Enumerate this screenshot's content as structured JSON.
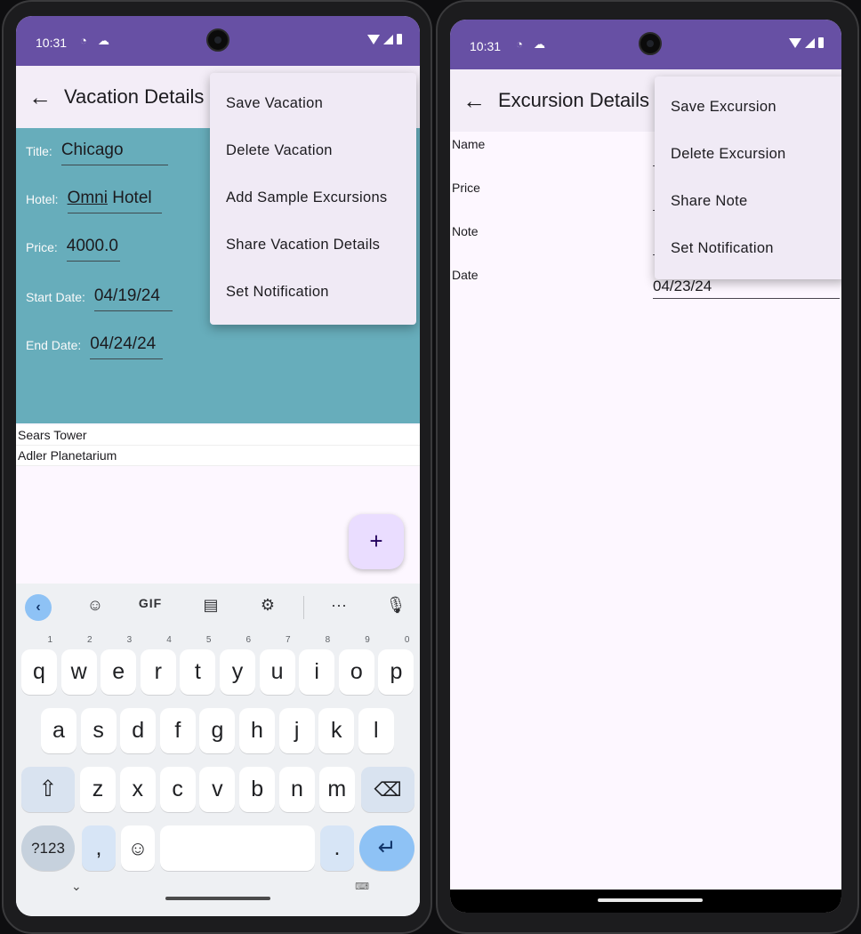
{
  "status_bar": {
    "time": "10:31"
  },
  "left_screen": {
    "app_bar": {
      "title": "Vacation Details"
    },
    "fields": [
      {
        "label": "Title:",
        "value": "Chicago"
      },
      {
        "label": "Hotel:",
        "value_underlined": "Omni",
        "value_rest": " Hotel"
      },
      {
        "label": "Price:",
        "value": "4000.0"
      },
      {
        "label": "Start Date:",
        "value": "04/19/24"
      },
      {
        "label": "End Date:",
        "value": "04/24/24"
      }
    ],
    "excursions": [
      "Sears Tower",
      "Adler Planetarium"
    ],
    "fab_label": "+",
    "menu": [
      "Save Vacation",
      "Delete Vacation",
      "Add Sample Excursions",
      "Share Vacation Details",
      "Set Notification"
    ],
    "keyboard": {
      "toolbar": {
        "gif": "GIF",
        "more": "···"
      },
      "row1": [
        {
          "key": "q",
          "hint": "1"
        },
        {
          "key": "w",
          "hint": "2"
        },
        {
          "key": "e",
          "hint": "3"
        },
        {
          "key": "r",
          "hint": "4"
        },
        {
          "key": "t",
          "hint": "5"
        },
        {
          "key": "y",
          "hint": "6"
        },
        {
          "key": "u",
          "hint": "7"
        },
        {
          "key": "i",
          "hint": "8"
        },
        {
          "key": "o",
          "hint": "9"
        },
        {
          "key": "p",
          "hint": "0"
        }
      ],
      "row2": [
        "a",
        "s",
        "d",
        "f",
        "g",
        "h",
        "j",
        "k",
        "l"
      ],
      "row3": [
        "z",
        "x",
        "c",
        "v",
        "b",
        "n",
        "m"
      ],
      "symbols_key": "?123",
      "comma_key": ",",
      "period_key": ".",
      "emoji_key": "☺",
      "shift_key": "⇧",
      "backspace_key": "⌫",
      "enter_key": "↵"
    }
  },
  "right_screen": {
    "app_bar": {
      "title": "Excursion Details"
    },
    "field_labels": [
      "Name",
      "Price",
      "Note",
      "Date"
    ],
    "date_value": "04/23/24",
    "menu": [
      "Save Excursion",
      "Delete Excursion",
      "Share Note",
      "Set Notification"
    ]
  },
  "colors": {
    "primary": "#6750a4",
    "teal_panel": "#67adbb",
    "surface": "#fdf7ff",
    "fab": "#eaddff"
  }
}
